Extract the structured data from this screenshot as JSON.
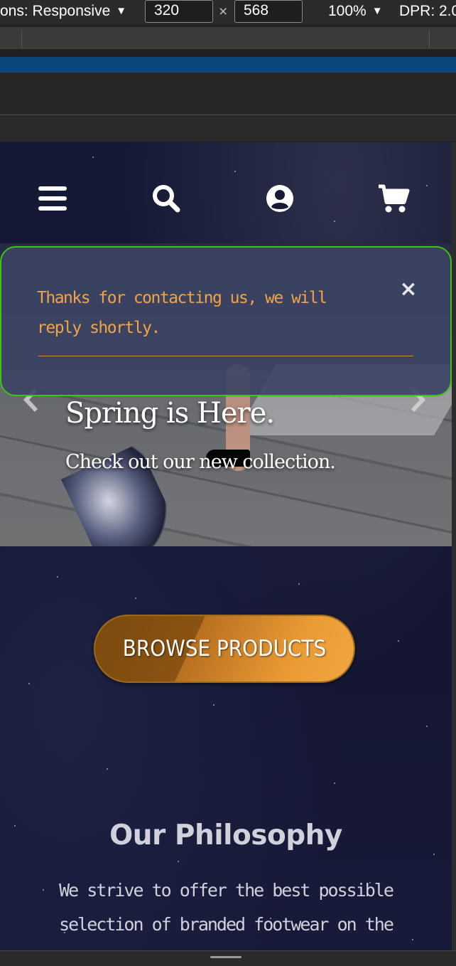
{
  "devtools": {
    "device_label": "ons: Responsive",
    "width_value": "320",
    "times_symbol": "×",
    "height_value": "568",
    "zoom_label": "100%",
    "dpr_label": "DPR: 2.0"
  },
  "nav": {
    "menu_icon": "hamburger-icon",
    "search_icon": "search-icon",
    "account_icon": "user-circle-icon",
    "cart_icon": "cart-icon"
  },
  "toast": {
    "message": "Thanks for contacting us, we will reply shortly.",
    "close_symbol": "×",
    "border_color": "#3ec316",
    "text_color": "#f0a446"
  },
  "hero": {
    "title": "Spring is Here.",
    "subtitle": "Check out our new collection."
  },
  "cta": {
    "label": "BROWSE PRODUCTS"
  },
  "philosophy": {
    "title": "Our Philosophy",
    "body": "We strive to offer the best possible selection of branded footwear on the"
  }
}
